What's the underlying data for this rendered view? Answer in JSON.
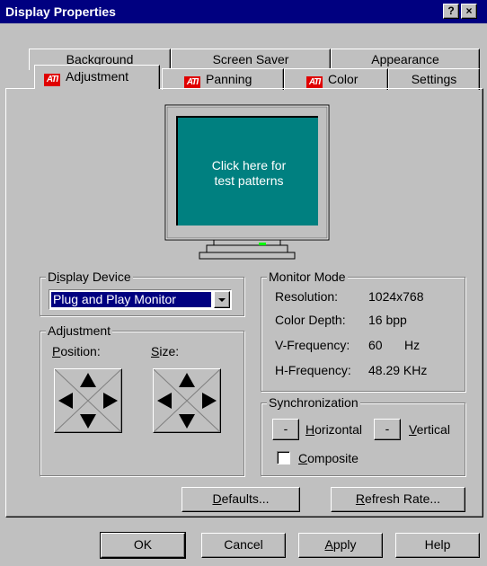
{
  "window": {
    "title": "Display Properties",
    "help_button": "?",
    "close_button": "×"
  },
  "tabs_back": [
    {
      "label": "Background"
    },
    {
      "label": "Screen Saver"
    },
    {
      "label": "Appearance"
    }
  ],
  "tabs_front": [
    {
      "label": "Adjustment",
      "icon": "ATI",
      "active": true
    },
    {
      "label": "Panning",
      "icon": "ATI"
    },
    {
      "label": "Color",
      "icon": "ATI"
    },
    {
      "label": "Settings"
    }
  ],
  "preview": {
    "line1": "Click here for",
    "line2": "test patterns",
    "screen_color": "#008080"
  },
  "display_device": {
    "title": "Display Device",
    "selected": "Plug and Play Monitor"
  },
  "adjustment": {
    "title": "Adjustment",
    "position_label": "Position:",
    "size_label": "Size:"
  },
  "monitor_mode": {
    "title": "Monitor Mode",
    "rows": [
      {
        "label": "Resolution:",
        "value": "1024x768"
      },
      {
        "label": "Color Depth:",
        "value": "16 bpp"
      },
      {
        "label": "V-Frequency:",
        "value": "60",
        "unit": "Hz"
      },
      {
        "label": "H-Frequency:",
        "value": "48.29 KHz"
      }
    ]
  },
  "sync": {
    "title": "Synchronization",
    "horizontal_label": "Horizontal",
    "vertical_label": "Vertical",
    "toggle_glyph": "-",
    "composite_label": "Composite",
    "composite_checked": false
  },
  "buttons": {
    "defaults": "Defaults...",
    "refresh": "Refresh Rate...",
    "ok": "OK",
    "cancel": "Cancel",
    "apply": "Apply",
    "help": "Help"
  }
}
